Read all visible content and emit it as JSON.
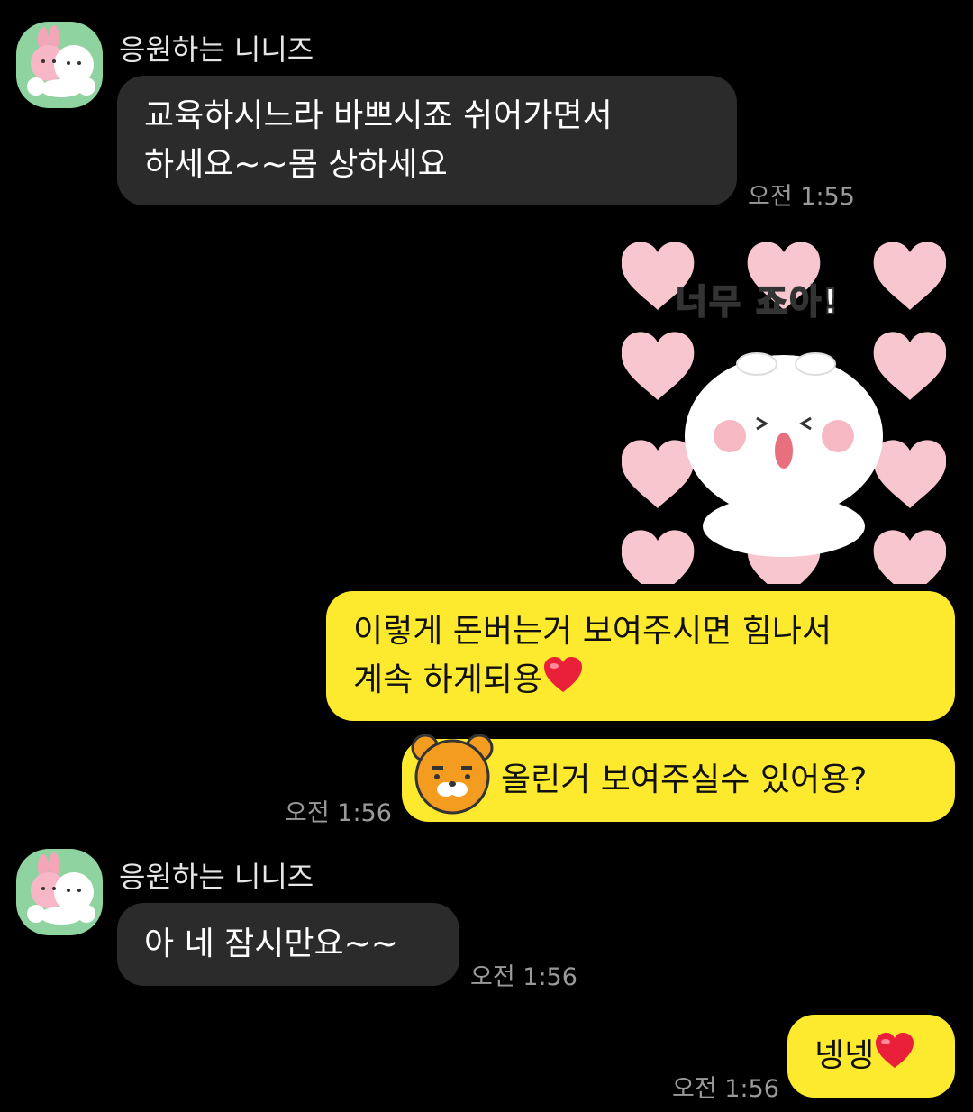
{
  "messages": [
    {
      "sender": "응원하는 니니즈",
      "text_line1": "교육하시느라 바쁘시죠 쉬어가면서",
      "text_line2": "하세요~~몸 상하세요",
      "time": "오전 1:55"
    },
    {
      "sticker_caption": "너무 죠아!"
    },
    {
      "text_line1": "이렇게 돈버는거 보여주시면 힘나서",
      "text_line2": "계속 하게되용"
    },
    {
      "text": "올린거 보여주실수 있어용?",
      "time": "오전 1:56"
    },
    {
      "sender": "응원하는 니니즈",
      "text": "아 네 잠시만요~~",
      "time": "오전 1:56"
    },
    {
      "text": "넹넹",
      "time": "오전 1:56"
    }
  ],
  "colors": {
    "incoming_bubble": "#2b2b2b",
    "outgoing_bubble": "#fdea2f",
    "avatar_bg": "#8fd3a0"
  },
  "icons": {
    "heart": "red-heart-emoji",
    "ryan": "ryan-character-emoticon"
  }
}
